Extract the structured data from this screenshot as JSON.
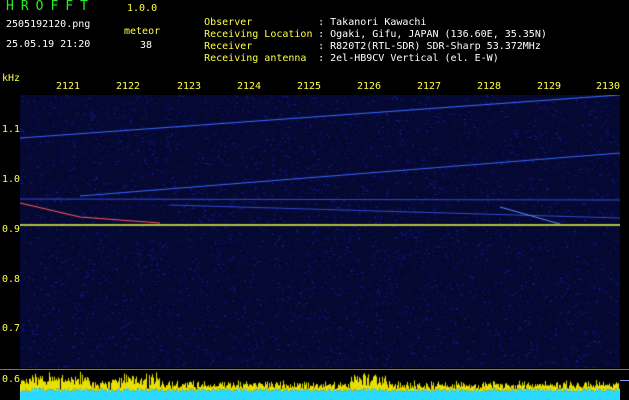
{
  "header": {
    "app_title": "HROFFT",
    "app_version": "1.0.0",
    "file_name": "2505192120.png",
    "datetime": "25.05.19 21:20",
    "meteor_label": "meteor",
    "meteor_count": "38"
  },
  "info": [
    {
      "label": "Observer",
      "value": ": Takanori Kawachi"
    },
    {
      "label": "Receiving Location",
      "value": ": Ogaki, Gifu, JAPAN (136.60E, 35.35N)"
    },
    {
      "label": "Receiver",
      "value": ": R820T2(RTL-SDR) SDR-Sharp 53.372MHz"
    },
    {
      "label": "Receiving antenna",
      "value": ": 2el-HB9CV Vertical (el. E-W)"
    }
  ],
  "axis": {
    "y_unit": "kHz",
    "x_ticks": [
      "2121",
      "2122",
      "2123",
      "2124",
      "2125",
      "2126",
      "2127",
      "2128",
      "2129",
      "2130"
    ],
    "y_ticks": [
      "1.1",
      "1.0",
      "0.9",
      "0.8",
      "0.7",
      "0.6"
    ]
  },
  "colors": {
    "accent_green": "#22ee22",
    "label_yellow": "#ffff44",
    "carrier_line": "#e8ff40",
    "trace_blue": "#4a7cff",
    "background_noise": "#0a0f6e",
    "level_yellow": "#e8e000",
    "level_cyan": "#28d8ff"
  }
}
